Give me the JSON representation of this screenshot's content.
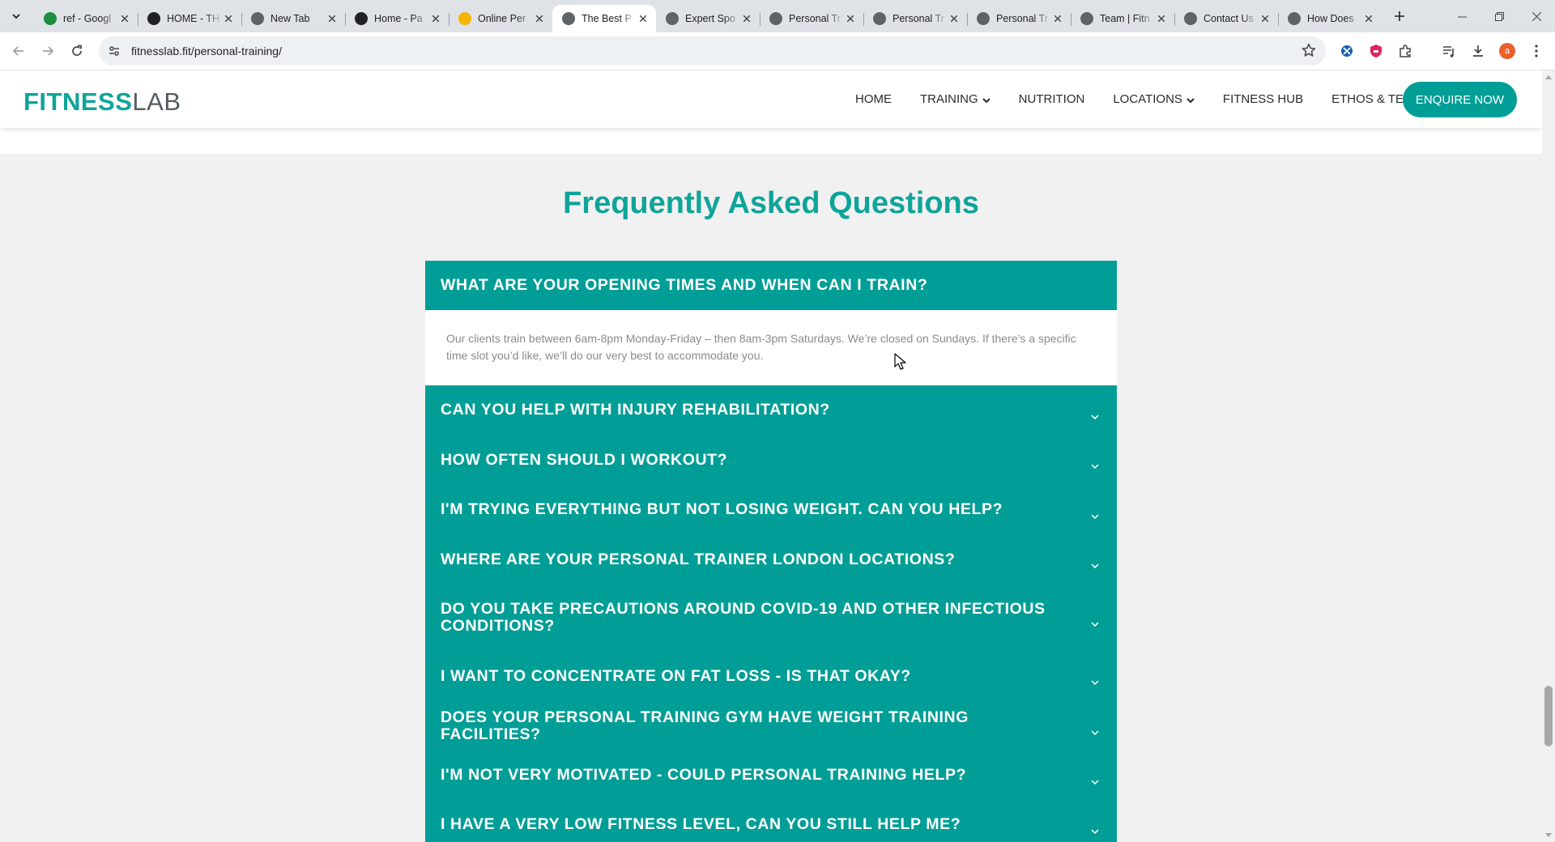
{
  "browser": {
    "tabs": [
      {
        "title": "ref - Googl",
        "favicon": "google-sheets-icon",
        "color": "#1e8e3e",
        "active": false
      },
      {
        "title": "HOME - TH",
        "favicon": "trm-icon",
        "color": "#202124",
        "active": false
      },
      {
        "title": "New Tab",
        "favicon": "chrome-icon",
        "color": "#5f6368",
        "active": false
      },
      {
        "title": "Home - Pa",
        "favicon": "site-icon",
        "color": "#202124",
        "active": false
      },
      {
        "title": "Online Per",
        "favicon": "person-icon",
        "color": "#f4b400",
        "active": false
      },
      {
        "title": "The Best P",
        "favicon": "fitnesslab-icon",
        "color": "#5f6368",
        "active": true
      },
      {
        "title": "Expert Spo",
        "favicon": "fitnesslab-icon",
        "color": "#5f6368",
        "active": false
      },
      {
        "title": "Personal Tr",
        "favicon": "fitnesslab-icon",
        "color": "#5f6368",
        "active": false
      },
      {
        "title": "Personal Tr",
        "favicon": "fitnesslab-icon",
        "color": "#5f6368",
        "active": false
      },
      {
        "title": "Personal Tr",
        "favicon": "fitnesslab-icon",
        "color": "#5f6368",
        "active": false
      },
      {
        "title": "Team | Fitn",
        "favicon": "fitnesslab-icon",
        "color": "#5f6368",
        "active": false
      },
      {
        "title": "Contact Us",
        "favicon": "fitnesslab-icon",
        "color": "#5f6368",
        "active": false
      },
      {
        "title": "How Does",
        "favicon": "fitnesslab-icon",
        "color": "#5f6368",
        "active": false
      }
    ],
    "url": "fitnesslab.fit/personal-training/",
    "profile_initial": "a"
  },
  "site": {
    "logo_bold": "FITNESS",
    "logo_light": "LAB",
    "brand_color": "#009e96",
    "nav": [
      {
        "label": "HOME",
        "dropdown": false
      },
      {
        "label": "TRAINING",
        "dropdown": true
      },
      {
        "label": "NUTRITION",
        "dropdown": false
      },
      {
        "label": "LOCATIONS",
        "dropdown": true
      },
      {
        "label": "FITNESS HUB",
        "dropdown": false
      },
      {
        "label": "ETHOS & TEAM",
        "dropdown": true
      }
    ],
    "cta": "ENQUIRE NOW"
  },
  "faq": {
    "title": "Frequently Asked Questions",
    "items": [
      {
        "question": "WHAT ARE YOUR OPENING TIMES AND WHEN CAN I TRAIN?",
        "expanded": true,
        "answer": "Our clients train between 6am-8pm Monday-Friday – then 8am-3pm Saturdays. We’re closed on Sundays. If there’s a specific time slot you’d like, we’ll do our very best to accommodate you."
      },
      {
        "question": "CAN YOU HELP WITH INJURY REHABILITATION?",
        "expanded": false
      },
      {
        "question": "HOW OFTEN SHOULD I WORKOUT?",
        "expanded": false
      },
      {
        "question": "I'M TRYING EVERYTHING BUT NOT LOSING WEIGHT. CAN YOU HELP?",
        "expanded": false
      },
      {
        "question": "WHERE ARE YOUR PERSONAL TRAINER LONDON LOCATIONS?",
        "expanded": false
      },
      {
        "question": "DO YOU TAKE PRECAUTIONS AROUND COVID-19 AND OTHER INFECTIOUS CONDITIONS?",
        "expanded": false
      },
      {
        "question": "I WANT TO CONCENTRATE ON FAT LOSS - IS THAT OKAY?",
        "expanded": false
      },
      {
        "question": "DOES YOUR PERSONAL TRAINING GYM HAVE WEIGHT TRAINING FACILITIES?",
        "expanded": false
      },
      {
        "question": "I'M NOT VERY MOTIVATED - COULD PERSONAL TRAINING HELP?",
        "expanded": false
      },
      {
        "question": "I HAVE A VERY LOW FITNESS LEVEL, CAN YOU STILL HELP ME?",
        "expanded": false
      }
    ]
  }
}
